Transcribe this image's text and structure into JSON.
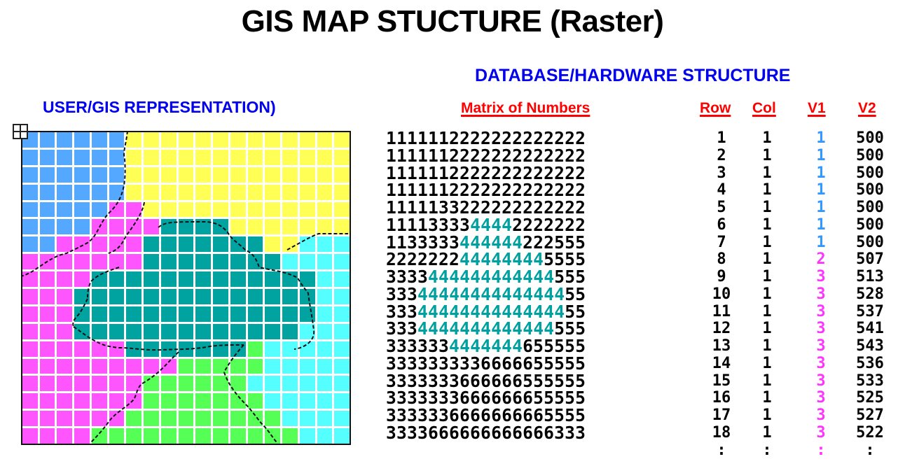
{
  "title": "GIS MAP STUCTURE (Raster)",
  "database_heading": "DATABASE/HARDWARE STRUCTURE",
  "user_heading": "USER/GIS REPRESENTATION)",
  "columns": {
    "matrix": "Matrix of Numbers",
    "row": "Row",
    "col": "Col",
    "v1": "V1",
    "v2": "V2"
  },
  "colors": {
    "title": "#000000",
    "heading_blue": "#0000ee",
    "header_red": "#ff0000",
    "teal_text": "#00a0a0",
    "v1_blue": "#3399ff",
    "v1_magenta": "#ff33ff",
    "class_colors": {
      "1": "#55a8ff",
      "2": "#ffff55",
      "3": "#ff55ff",
      "4": "#00a39f",
      "5": "#55ffff",
      "6": "#55ff55"
    }
  },
  "matrix": [
    "1111112222222222222",
    "1111112222222222222",
    "1111112222222222222",
    "1111112222222222222",
    "1111133222222222222",
    "1111333344442222222",
    "1133333444444222555",
    "2222222444444445555",
    "3333444444444444555",
    "3334444444444444455",
    "3334444444444444455",
    "3334444444444444555",
    "3333334444444655555",
    "3333333336666655555",
    "3333333666666555555",
    "3333333666666655555",
    "3333336666666665555",
    "3333666666666666333"
  ],
  "table": {
    "rows": [
      {
        "row": "1",
        "col": "1",
        "v1": "1",
        "v2": "500"
      },
      {
        "row": "2",
        "col": "1",
        "v1": "1",
        "v2": "500"
      },
      {
        "row": "3",
        "col": "1",
        "v1": "1",
        "v2": "500"
      },
      {
        "row": "4",
        "col": "1",
        "v1": "1",
        "v2": "500"
      },
      {
        "row": "5",
        "col": "1",
        "v1": "1",
        "v2": "500"
      },
      {
        "row": "6",
        "col": "1",
        "v1": "1",
        "v2": "500"
      },
      {
        "row": "7",
        "col": "1",
        "v1": "1",
        "v2": "500"
      },
      {
        "row": "8",
        "col": "1",
        "v1": "2",
        "v2": "507"
      },
      {
        "row": "9",
        "col": "1",
        "v1": "3",
        "v2": "513"
      },
      {
        "row": "10",
        "col": "1",
        "v1": "3",
        "v2": "528"
      },
      {
        "row": "11",
        "col": "1",
        "v1": "3",
        "v2": "537"
      },
      {
        "row": "12",
        "col": "1",
        "v1": "3",
        "v2": "541"
      },
      {
        "row": "13",
        "col": "1",
        "v1": "3",
        "v2": "543"
      },
      {
        "row": "14",
        "col": "1",
        "v1": "3",
        "v2": "536"
      },
      {
        "row": "15",
        "col": "1",
        "v1": "3",
        "v2": "533"
      },
      {
        "row": "16",
        "col": "1",
        "v1": "3",
        "v2": "525"
      },
      {
        "row": "17",
        "col": "1",
        "v1": "3",
        "v2": "527"
      },
      {
        "row": "18",
        "col": "1",
        "v1": "3",
        "v2": "522"
      }
    ],
    "continuation": ":"
  },
  "map_grid": [
    "1111112222222222222",
    "1111112222222222222",
    "1111112222222222222",
    "1111112222222222222",
    "1111133222222222222",
    "1111333344442222222",
    "1133333444444422555",
    "3333333444444445555",
    "3333444444444444455",
    "3334444444444444455",
    "3334444444444444455",
    "3334444444444444555",
    "3333334444444655555",
    "3333333336666655555",
    "3333333666666555555",
    "3333333666666655555",
    "3333336666666665555",
    "3333666666666666555"
  ]
}
